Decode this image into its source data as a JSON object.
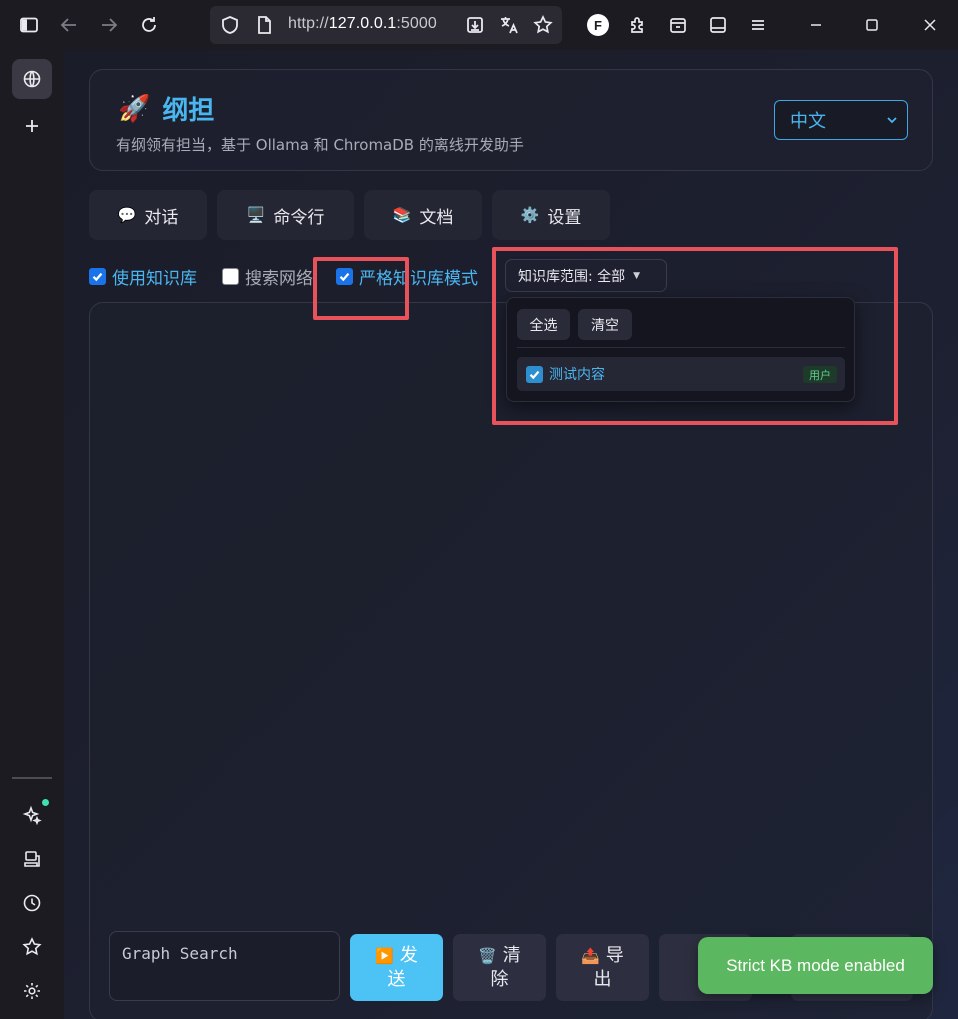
{
  "browser": {
    "url_prefix": "http://",
    "url_host": "127.0.0.1",
    "url_suffix": ":5000",
    "profile_letter": "F",
    "icons": [
      "sidebar-toggle-icon",
      "back-arrow-icon",
      "forward-arrow-icon",
      "reload-icon",
      "shield-icon",
      "page-icon",
      "download-icon",
      "translate-icon",
      "star-icon",
      "extensions-icon",
      "container-icon",
      "reader-icon",
      "menu-icon",
      "minimize-icon",
      "maximize-icon",
      "close-icon"
    ]
  },
  "sidebar": {
    "icons": [
      "globe-icon",
      "plus-icon",
      "sparkle-icon",
      "devices-icon",
      "history-icon",
      "bookmark-star-icon",
      "settings-gear-icon"
    ]
  },
  "header": {
    "icon": "🚀",
    "title": "纲担",
    "subtitle": "有纲领有担当，基于 Ollama 和 ChromaDB 的离线开发助手",
    "language": "中文"
  },
  "tabs": [
    {
      "icon": "💬",
      "label": "对话"
    },
    {
      "icon": "🖥️",
      "label": "命令行"
    },
    {
      "icon": "📚",
      "label": "文档"
    },
    {
      "icon": "⚙️",
      "label": "设置"
    }
  ],
  "options": {
    "use_kb": {
      "label": "使用知识库",
      "checked": true
    },
    "web_search": {
      "label": "搜索网络",
      "checked": false
    },
    "strict_kb": {
      "label": "严格知识库模式",
      "checked": true
    }
  },
  "kb_scope": {
    "label": "知识库范围: 全部",
    "caret": "▼",
    "select_all": "全选",
    "clear": "清空",
    "items": [
      {
        "name": "测试内容",
        "badge": "用户",
        "checked": true
      }
    ]
  },
  "composer": {
    "value": "Graph Search"
  },
  "actions": [
    {
      "icon": "▶️",
      "line1": "发",
      "line2": "送"
    },
    {
      "icon": "🗑️",
      "line1": "清",
      "line2": "除"
    },
    {
      "icon": "📤",
      "line1": "导",
      "line2": "出"
    }
  ],
  "toast": "Strict KB mode enabled",
  "colors": {
    "accent": "#4ab6f0",
    "highlight": "#e8525a",
    "toast": "#5cb860"
  }
}
